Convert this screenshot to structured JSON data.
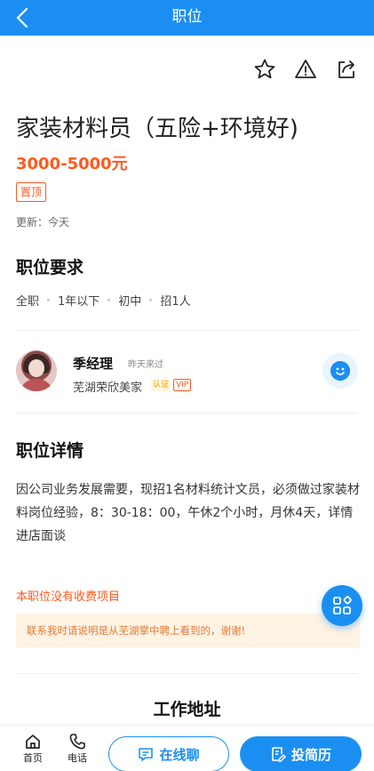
{
  "header": {
    "title": "职位"
  },
  "icons": {
    "back": "chevron-left-icon",
    "favorite": "star-icon",
    "report": "warning-icon",
    "share": "share-icon"
  },
  "job": {
    "title": "家装材料员（五险+环境好)",
    "salary": "3000-5000元",
    "tag": "置顶",
    "updated": "更新：今天"
  },
  "requirements": {
    "heading": "职位要求",
    "items": [
      "全职",
      "1年以下",
      "初中",
      "招1人"
    ]
  },
  "recruiter": {
    "name": "季经理",
    "last_seen": "昨天来过",
    "company": "芜湖荣欣美家",
    "badge_auth": "认证",
    "badge_vip": "VIP"
  },
  "details": {
    "heading": "职位详情",
    "description": "因公司业务发展需要，现招1名材料统计文员，必须做过家装材料岗位经验，8：30-18：00，午休2个小时，月休4天，详情进店面谈"
  },
  "fees": {
    "no_fee": "本职位没有收费项目",
    "notice": "联系我时请说明是从芜湖掌中聘上看到的，谢谢!"
  },
  "address": {
    "heading": "工作地址"
  },
  "bottom": {
    "home_label": "首页",
    "phone_label": "电话",
    "chat_label": "在线聊",
    "resume_label": "投简历"
  },
  "colors": {
    "primary": "#1b8ff1",
    "accent": "#ff5a1f"
  }
}
